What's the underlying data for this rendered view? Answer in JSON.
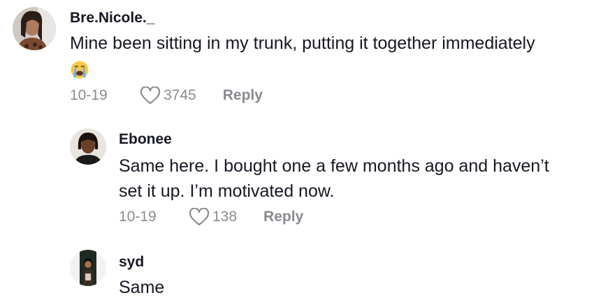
{
  "comments": [
    {
      "username": "Bre.Nicole._",
      "text": "Mine been sitting in my trunk, putting it together immediately",
      "emoji": "loudly-crying-face",
      "date": "10-19",
      "likes": "3745",
      "reply_label": "Reply"
    },
    {
      "username": "Ebonee",
      "text_line1": "Same here. I bought one a few months ago and haven’t",
      "text_line2": "set it up. I’m motivated now.",
      "date": "10-19",
      "likes": "138",
      "reply_label": "Reply"
    },
    {
      "username": "syd",
      "text": "Same"
    }
  ],
  "colors": {
    "text": "#161823",
    "meta": "#8a8b91"
  }
}
